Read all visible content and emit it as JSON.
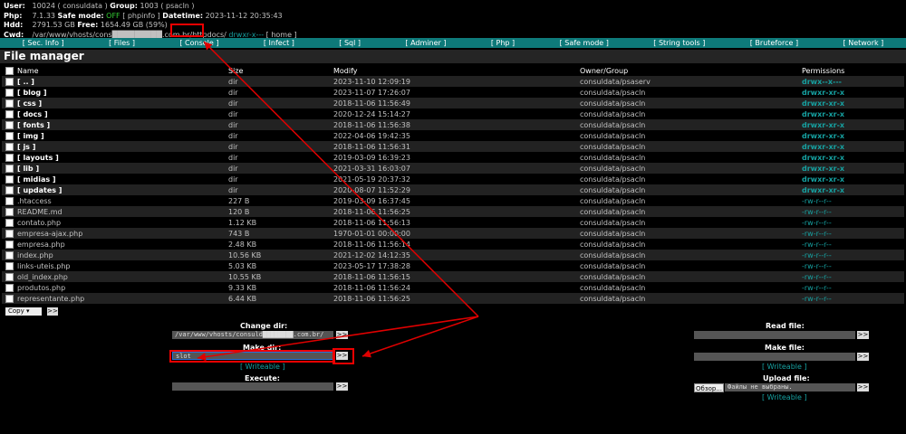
{
  "info": {
    "user_label": "User:",
    "user_value": "10024 ( consuldata )",
    "group_label": "Group:",
    "group_value": "1003 ( psacln )",
    "php_label": "Php:",
    "php_version": "7.1.33",
    "safemode_label": "Safe mode:",
    "safemode_value": "OFF",
    "phpinfo_link": "[ phpinfo ]",
    "datetime_label": "Datetime:",
    "datetime_value": "2023-11-12 20:35:43",
    "hdd_label": "Hdd:",
    "hdd_total": "2791.53 GB",
    "free_label": "Free:",
    "free_value": "1654.49 GB (59%)",
    "cwd_label": "Cwd:",
    "cwd_path": "/var/www/vhosts/cons█████████.com.br/",
    "cwd_httpdocs": "httpdocs/",
    "cwd_perm": "drwxr-x---",
    "cwd_home": "[ home ]"
  },
  "nav": [
    "[ Sec. Info ]",
    "[ Files ]",
    "[ Console ]",
    "[ Infect ]",
    "[ Sql ]",
    "[ Adminer ]",
    "[ Php ]",
    "[ Safe mode ]",
    "[ String tools ]",
    "[ Bruteforce ]",
    "[ Network ]"
  ],
  "fm_title": "File manager",
  "columns": {
    "name": "Name",
    "size": "Size",
    "modify": "Modify",
    "owner": "Owner/Group",
    "perms": "Permissions"
  },
  "files": [
    {
      "name": "[ .. ]",
      "size": "dir",
      "modify": "2023-11-10 12:09:19",
      "owner": "consuldata/psaserv",
      "perm": "drwx--x---",
      "dir": true
    },
    {
      "name": "[ blog ]",
      "size": "dir",
      "modify": "2023-11-07 17:26:07",
      "owner": "consuldata/psacln",
      "perm": "drwxr-xr-x",
      "dir": true
    },
    {
      "name": "[ css ]",
      "size": "dir",
      "modify": "2018-11-06 11:56:49",
      "owner": "consuldata/psacln",
      "perm": "drwxr-xr-x",
      "dir": true
    },
    {
      "name": "[ docs ]",
      "size": "dir",
      "modify": "2020-12-24 15:14:27",
      "owner": "consuldata/psacln",
      "perm": "drwxr-xr-x",
      "dir": true
    },
    {
      "name": "[ fonts ]",
      "size": "dir",
      "modify": "2018-11-06 11:56:38",
      "owner": "consuldata/psacln",
      "perm": "drwxr-xr-x",
      "dir": true
    },
    {
      "name": "[ img ]",
      "size": "dir",
      "modify": "2022-04-06 19:42:35",
      "owner": "consuldata/psacln",
      "perm": "drwxr-xr-x",
      "dir": true
    },
    {
      "name": "[ js ]",
      "size": "dir",
      "modify": "2018-11-06 11:56:31",
      "owner": "consuldata/psacln",
      "perm": "drwxr-xr-x",
      "dir": true
    },
    {
      "name": "[ layouts ]",
      "size": "dir",
      "modify": "2019-03-09 16:39:23",
      "owner": "consuldata/psacln",
      "perm": "drwxr-xr-x",
      "dir": true
    },
    {
      "name": "[ lib ]",
      "size": "dir",
      "modify": "2021-03-31 16:03:07",
      "owner": "consuldata/psacln",
      "perm": "drwxr-xr-x",
      "dir": true
    },
    {
      "name": "[ midias ]",
      "size": "dir",
      "modify": "2021-05-19 20:37:32",
      "owner": "consuldata/psacln",
      "perm": "drwxr-xr-x",
      "dir": true
    },
    {
      "name": "[ updates ]",
      "size": "dir",
      "modify": "2020-08-07 11:52:29",
      "owner": "consuldata/psacln",
      "perm": "drwxr-xr-x",
      "dir": true
    },
    {
      "name": ".htaccess",
      "size": "227 B",
      "modify": "2019-03-09 16:37:45",
      "owner": "consuldata/psacln",
      "perm": "-rw-r--r--",
      "dir": false
    },
    {
      "name": "README.md",
      "size": "120 B",
      "modify": "2018-11-06 11:56:25",
      "owner": "consuldata/psacln",
      "perm": "-rw-r--r--",
      "dir": false
    },
    {
      "name": "contato.php",
      "size": "1.12 KB",
      "modify": "2018-11-06 11:56:13",
      "owner": "consuldata/psacln",
      "perm": "-rw-r--r--",
      "dir": false
    },
    {
      "name": "empresa-ajax.php",
      "size": "743 B",
      "modify": "1970-01-01 00:00:00",
      "owner": "consuldata/psacln",
      "perm": "-rw-r--r--",
      "dir": false
    },
    {
      "name": "empresa.php",
      "size": "2.48 KB",
      "modify": "2018-11-06 11:56:14",
      "owner": "consuldata/psacln",
      "perm": "-rw-r--r--",
      "dir": false
    },
    {
      "name": "index.php",
      "size": "10.56 KB",
      "modify": "2021-12-02 14:12:35",
      "owner": "consuldata/psacln",
      "perm": "-rw-r--r--",
      "dir": false
    },
    {
      "name": "links-uteis.php",
      "size": "5.03 KB",
      "modify": "2023-05-17 17:38:28",
      "owner": "consuldata/psacln",
      "perm": "-rw-r--r--",
      "dir": false
    },
    {
      "name": "old_index.php",
      "size": "10.55 KB",
      "modify": "2018-11-06 11:56:15",
      "owner": "consuldata/psacln",
      "perm": "-rw-r--r--",
      "dir": false
    },
    {
      "name": "produtos.php",
      "size": "9.33 KB",
      "modify": "2018-11-06 11:56:24",
      "owner": "consuldata/psacln",
      "perm": "-rw-r--r--",
      "dir": false
    },
    {
      "name": "representante.php",
      "size": "6.44 KB",
      "modify": "2018-11-06 11:56:25",
      "owner": "consuldata/psacln",
      "perm": "-rw-r--r--",
      "dir": false
    }
  ],
  "copy_select": "Copy",
  "go": ">>",
  "change_dir_label": "Change dir:",
  "change_dir_value": "/var/www/vhosts/consuld████████.com.br/",
  "make_dir_label": "Make dir:",
  "make_dir_value": "slot",
  "writeable": "[ Writeable ]",
  "execute_label": "Execute:",
  "read_file_label": "Read file:",
  "make_file_label": "Make file:",
  "upload_file_label": "Upload file:",
  "browse_button": "Обзор...",
  "no_file_text": "Файлы не выбраны.",
  "colors": {
    "teal": "#16a1a1",
    "nav_bg": "#0e7a7a",
    "annotation_red": "#e00000"
  }
}
